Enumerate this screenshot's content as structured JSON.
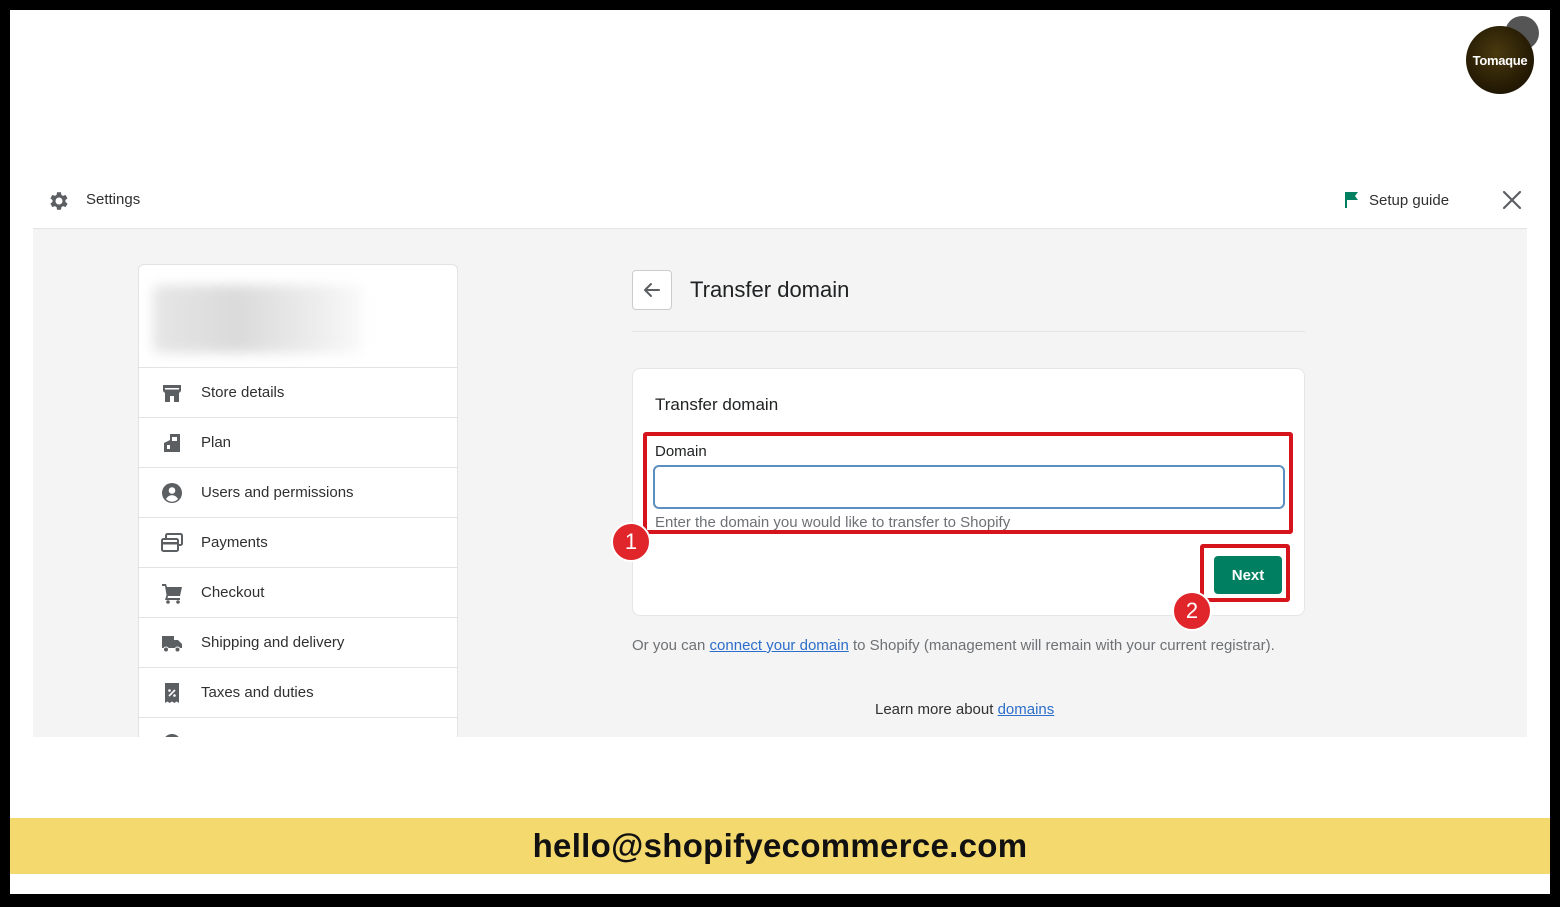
{
  "brand": {
    "logo_text": "Tomaque"
  },
  "topbar": {
    "title": "Settings",
    "setup_guide": "Setup guide",
    "icons": {
      "settings": "gear-icon",
      "setup": "flag-icon",
      "close": "close-icon"
    }
  },
  "sidebar": {
    "items": [
      {
        "label": "Store details",
        "icon": "store-icon"
      },
      {
        "label": "Plan",
        "icon": "plan-icon"
      },
      {
        "label": "Users and permissions",
        "icon": "user-icon"
      },
      {
        "label": "Payments",
        "icon": "payments-icon"
      },
      {
        "label": "Checkout",
        "icon": "cart-icon"
      },
      {
        "label": "Shipping and delivery",
        "icon": "truck-icon"
      },
      {
        "label": "Taxes and duties",
        "icon": "tax-icon"
      }
    ]
  },
  "page": {
    "title": "Transfer domain",
    "card": {
      "title": "Transfer domain",
      "field_label": "Domain",
      "field_value": "",
      "field_placeholder": "",
      "help_text": "Enter the domain you would like to transfer to Shopify",
      "next_label": "Next"
    },
    "connect": {
      "prefix": "Or you can ",
      "link": "connect your domain",
      "suffix": " to Shopify (management will remain with your current registrar)."
    },
    "learn": {
      "prefix": "Learn more about ",
      "link": "domains"
    }
  },
  "annotations": {
    "step1": "1",
    "step2": "2",
    "highlight_color": "#d6141c"
  },
  "banner": {
    "text": "hello@shopifyecommerce.com",
    "color": "#f4d96e"
  },
  "colors": {
    "primary_button": "#008060",
    "link": "#2c6ecb"
  }
}
